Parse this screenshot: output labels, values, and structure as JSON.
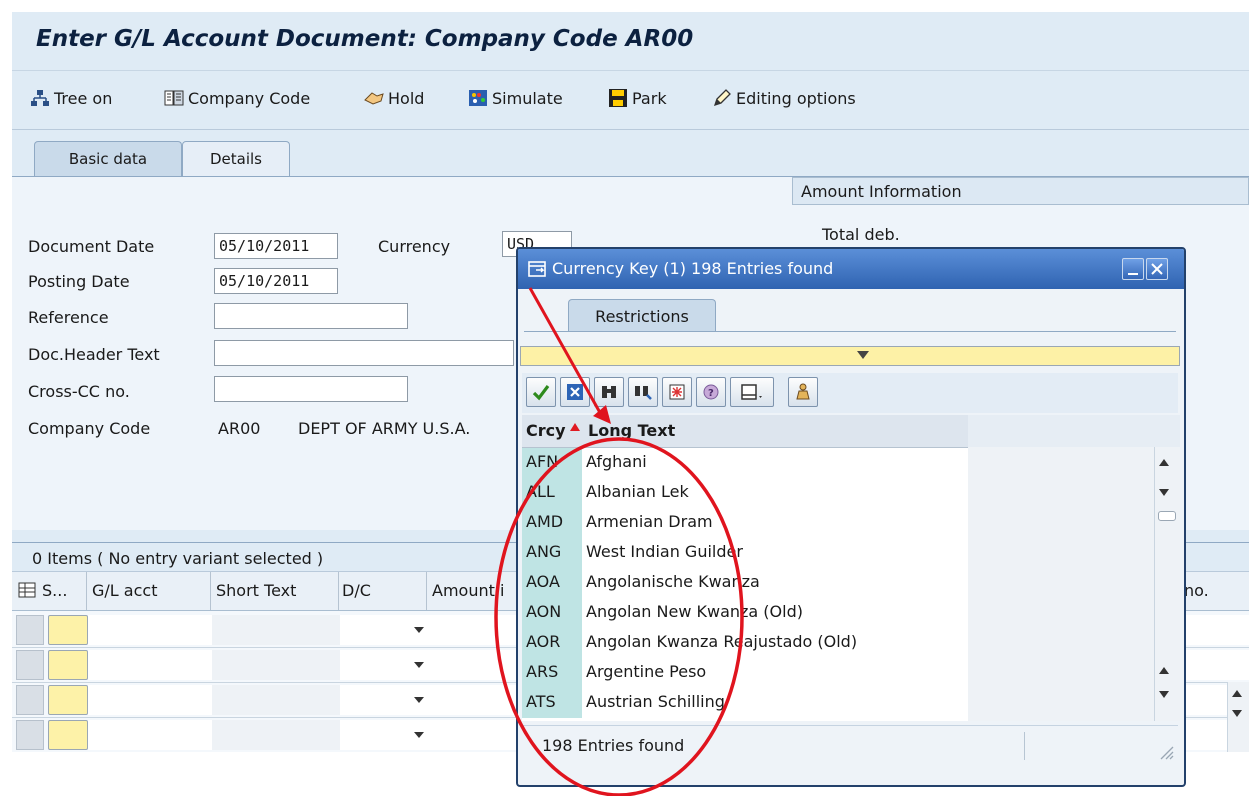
{
  "window": {
    "title": "Enter G/L Account Document: Company Code AR00"
  },
  "toolbar": {
    "tree_on": "Tree on",
    "company_code": "Company Code",
    "hold": "Hold",
    "simulate": "Simulate",
    "park": "Park",
    "editing_options": "Editing options"
  },
  "tabs": {
    "basic_data": "Basic data",
    "details": "Details"
  },
  "form": {
    "document_date_label": "Document Date",
    "document_date_value": "05/10/2011",
    "posting_date_label": "Posting Date",
    "posting_date_value": "05/10/2011",
    "reference_label": "Reference",
    "doc_header_text_label": "Doc.Header Text",
    "cross_cc_label": "Cross-CC no.",
    "company_code_label": "Company Code",
    "company_code_value": "AR00",
    "company_name": "DEPT OF ARMY U.S.A.",
    "currency_label": "Currency",
    "currency_value": "USD"
  },
  "amount_info": {
    "header": "Amount Information",
    "total_deb": "Total deb."
  },
  "items": {
    "title": "0 Items ( No entry variant selected )",
    "columns": {
      "s": "S...",
      "gl_acct": "G/L acct",
      "short_text": "Short Text",
      "dc": "D/C",
      "amount": "Amount i",
      "right": "no."
    }
  },
  "popup": {
    "title": "Currency Key (1)  198 Entries found",
    "restrictions_tab": "Restrictions",
    "col_crcy": "Crcy",
    "col_long_text": "Long Text",
    "rows": [
      {
        "key": "AFN",
        "text": "Afghani"
      },
      {
        "key": "ALL",
        "text": "Albanian Lek"
      },
      {
        "key": "AMD",
        "text": "Armenian Dram"
      },
      {
        "key": "ANG",
        "text": "West Indian Guilder"
      },
      {
        "key": "AOA",
        "text": "Angolanische Kwanza"
      },
      {
        "key": "AON",
        "text": "Angolan New Kwanza (Old)"
      },
      {
        "key": "AOR",
        "text": "Angolan Kwanza Reajustado (Old)"
      },
      {
        "key": "ARS",
        "text": "Argentine Peso"
      },
      {
        "key": "ATS",
        "text": "Austrian Schilling"
      }
    ],
    "status": "198 Entries found"
  },
  "colors": {
    "annotation": "#e0141e",
    "title_bar": "#3f78c7",
    "key_column": "#bfe4e4",
    "required_field": "#fdf2a8"
  }
}
